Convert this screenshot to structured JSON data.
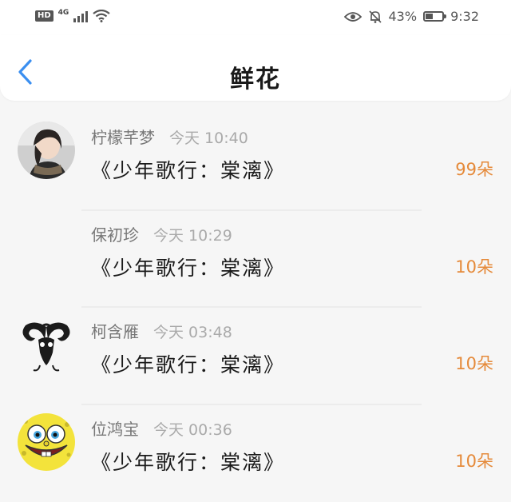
{
  "status_bar": {
    "hd": "HD",
    "network": "4G",
    "battery_percent": "43%",
    "battery_level": 0.43,
    "time": "9:32",
    "icons": [
      "signal-icon",
      "wifi-icon",
      "eye-icon",
      "bell-off-icon",
      "battery-icon"
    ]
  },
  "header": {
    "title": "鲜花",
    "back_icon": "chevron-left-icon"
  },
  "colors": {
    "accent_blue": "#3b8ff0",
    "flower_orange": "#e58a3a"
  },
  "list": [
    {
      "name": "柠檬芊梦",
      "time": "今天 10:40",
      "work": "《少年歌行：棠漓》",
      "count": "99朵",
      "avatar": "photo-avatar"
    },
    {
      "name": "保初珍",
      "time": "今天 10:29",
      "work": "《少年歌行：棠漓》",
      "count": "10朵",
      "avatar": "blank-avatar"
    },
    {
      "name": "柯含雁",
      "time": "今天 03:48",
      "work": "《少年歌行：棠漓》",
      "count": "10朵",
      "avatar": "tribal-ram-avatar"
    },
    {
      "name": "位鸿宝",
      "time": "今天 00:36",
      "work": "《少年歌行：棠漓》",
      "count": "10朵",
      "avatar": "sponge-avatar"
    }
  ]
}
